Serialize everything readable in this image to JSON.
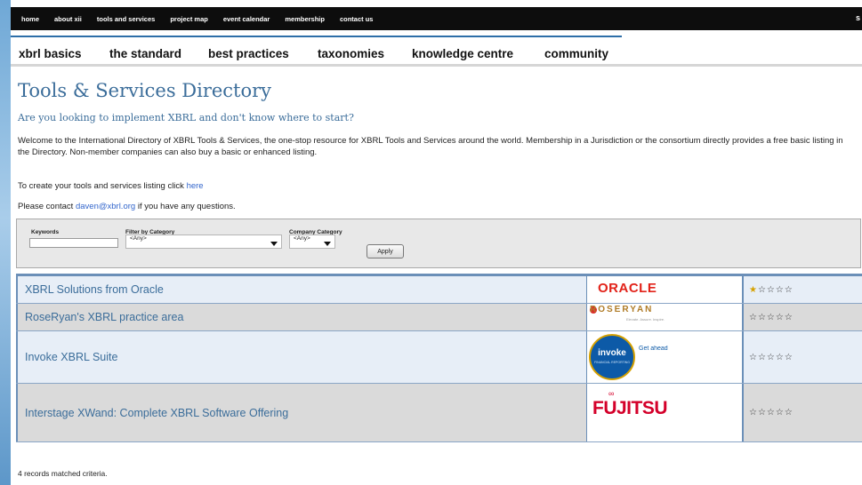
{
  "topnav": {
    "items": [
      "home",
      "about xii",
      "tools and services",
      "project map",
      "event calendar",
      "membership",
      "contact us"
    ],
    "right_text": "s"
  },
  "mainnav": {
    "tabs": [
      "xbrl basics",
      "the standard",
      "best practices",
      "taxonomies",
      "knowledge centre",
      "community"
    ]
  },
  "page": {
    "title": "Tools & Services Directory",
    "subtitle": "Are you looking to implement XBRL and don't know where to start?",
    "intro": "Welcome to the International Directory of XBRL Tools & Services, the one-stop resource for XBRL Tools and Services around the world.  Membership in a Jurisdiction or the consortium directly provides a free basic listing in the Directory.  Non-member companies can also buy a basic or enhanced listing.",
    "create_prefix": "To create your tools and services listing click",
    "create_link": "here",
    "contact_prefix": "Please contact",
    "contact_email": "daven@xbrl.org",
    "contact_suffix": "if you have any questions."
  },
  "filter": {
    "keywords_label": "Keywords",
    "keywords_value": "",
    "category_label": "Filter by Category",
    "category_value": "<Any>",
    "company_label": "Company Category",
    "company_value": "<Any>",
    "apply_label": "Apply"
  },
  "results": [
    {
      "title": "XBRL Solutions from Oracle",
      "logo": "ORACLE",
      "rating": 1,
      "stars_on": "★",
      "stars_off": "☆☆☆☆"
    },
    {
      "title": "RoseRyan's XBRL practice area",
      "logo": "ROSERYAN",
      "logo_tag": "Elevate. Assure. Inspire.",
      "rating": 0,
      "stars_on": "",
      "stars_off": "☆☆☆☆☆"
    },
    {
      "title": "Invoke XBRL Suite",
      "logo": "invoke",
      "logo_sub": "FINANCIAL REPORTING",
      "logo_tag": "Get ahead",
      "rating": 0,
      "stars_on": "",
      "stars_off": "☆☆☆☆☆"
    },
    {
      "title": "Interstage XWand: Complete XBRL Software Offering",
      "logo": "FUJITSU",
      "rating": 0,
      "stars_on": "",
      "stars_off": "☆☆☆☆☆"
    }
  ],
  "footer": {
    "records_text": "4 records matched criteria."
  },
  "colors": {
    "heading_blue": "#3b6d9a",
    "link_blue": "#3366cc",
    "oracle_red": "#e2231a",
    "fujitsu_red": "#d4002a",
    "invoke_blue": "#0d5aa7"
  }
}
